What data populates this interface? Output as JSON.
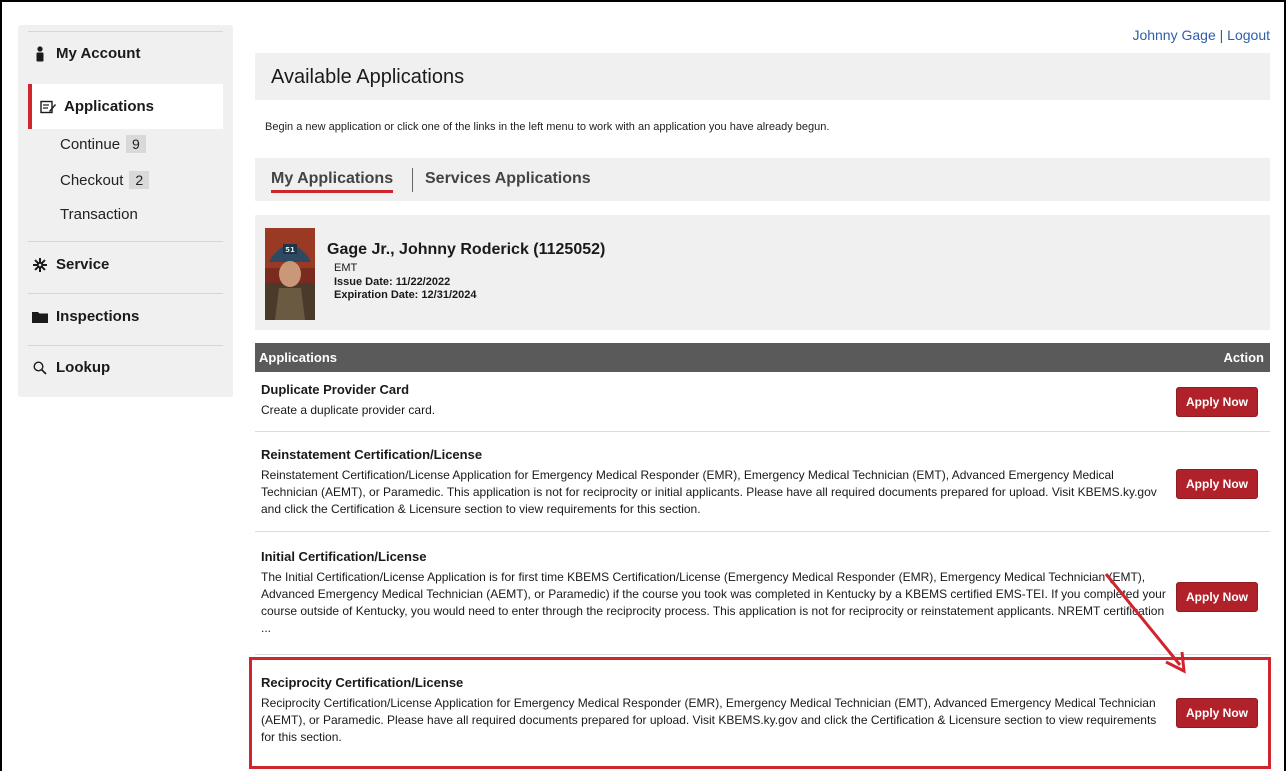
{
  "sidebar": {
    "my_account": "My Account",
    "applications": "Applications",
    "continue": {
      "label": "Continue",
      "count": "9"
    },
    "checkout": {
      "label": "Checkout",
      "count": "2"
    },
    "transaction": "Transaction",
    "service": "Service",
    "inspections": "Inspections",
    "lookup": "Lookup"
  },
  "header": {
    "user": "Johnny Gage",
    "separator": "|",
    "logout": "Logout"
  },
  "page": {
    "title": "Available Applications",
    "intro": "Begin a new application or click one of the links in the left menu to work with an application you have already begun.",
    "tabs": [
      "My Applications",
      "Services Applications"
    ]
  },
  "profile": {
    "name": "Gage Jr., Johnny Roderick (1125052)",
    "role": "EMT",
    "issue_label": "Issue Date:",
    "issue_date": "11/22/2022",
    "expiration_label": "Expiration Date:",
    "expiration_date": "12/31/2024",
    "helmet_number": "51"
  },
  "table": {
    "col_applications": "Applications",
    "col_action": "Action",
    "rows": [
      {
        "title": "Duplicate Provider Card",
        "desc": "Create a duplicate provider card.",
        "action": "Apply Now"
      },
      {
        "title": "Reinstatement Certification/License",
        "desc": "Reinstatement Certification/License Application for Emergency Medical Responder (EMR), Emergency Medical Technician (EMT), Advanced Emergency Medical Technician (AEMT), or Paramedic. This application is not for reciprocity or initial applicants. Please have all required documents prepared for upload. Visit KBEMS.ky.gov and click the Certification & Licensure section to view requirements for this section.",
        "action": "Apply Now"
      },
      {
        "title": "Initial Certification/License",
        "desc": "The Initial Certification/License Application is for first time KBEMS Certification/License (Emergency Medical Responder (EMR), Emergency Medical Technician (EMT), Advanced Emergency Medical Technician (AEMT), or Paramedic) if the course you took was completed in Kentucky by a KBEMS certified EMS-TEI. If you completed your course outside of Kentucky, you would need to enter through the reciprocity process. This application is not for reciprocity or reinstatement applicants. NREMT certification ...",
        "action": "Apply Now"
      },
      {
        "title": "Reciprocity Certification/License",
        "desc": "Reciprocity Certification/License Application for Emergency Medical Responder (EMR), Emergency Medical Technician (EMT), Advanced Emergency Medical Technician (AEMT), or Paramedic. Please have all required documents prepared for upload. Visit KBEMS.ky.gov and click the Certification & Licensure section to view requirements for this section.",
        "action": "Apply Now"
      }
    ]
  },
  "colors": {
    "accent": "#d0252d",
    "button": "#b0212a",
    "panel": "#f0f0f0",
    "table_header": "#5a5a5a",
    "link": "#2d5ea8"
  }
}
